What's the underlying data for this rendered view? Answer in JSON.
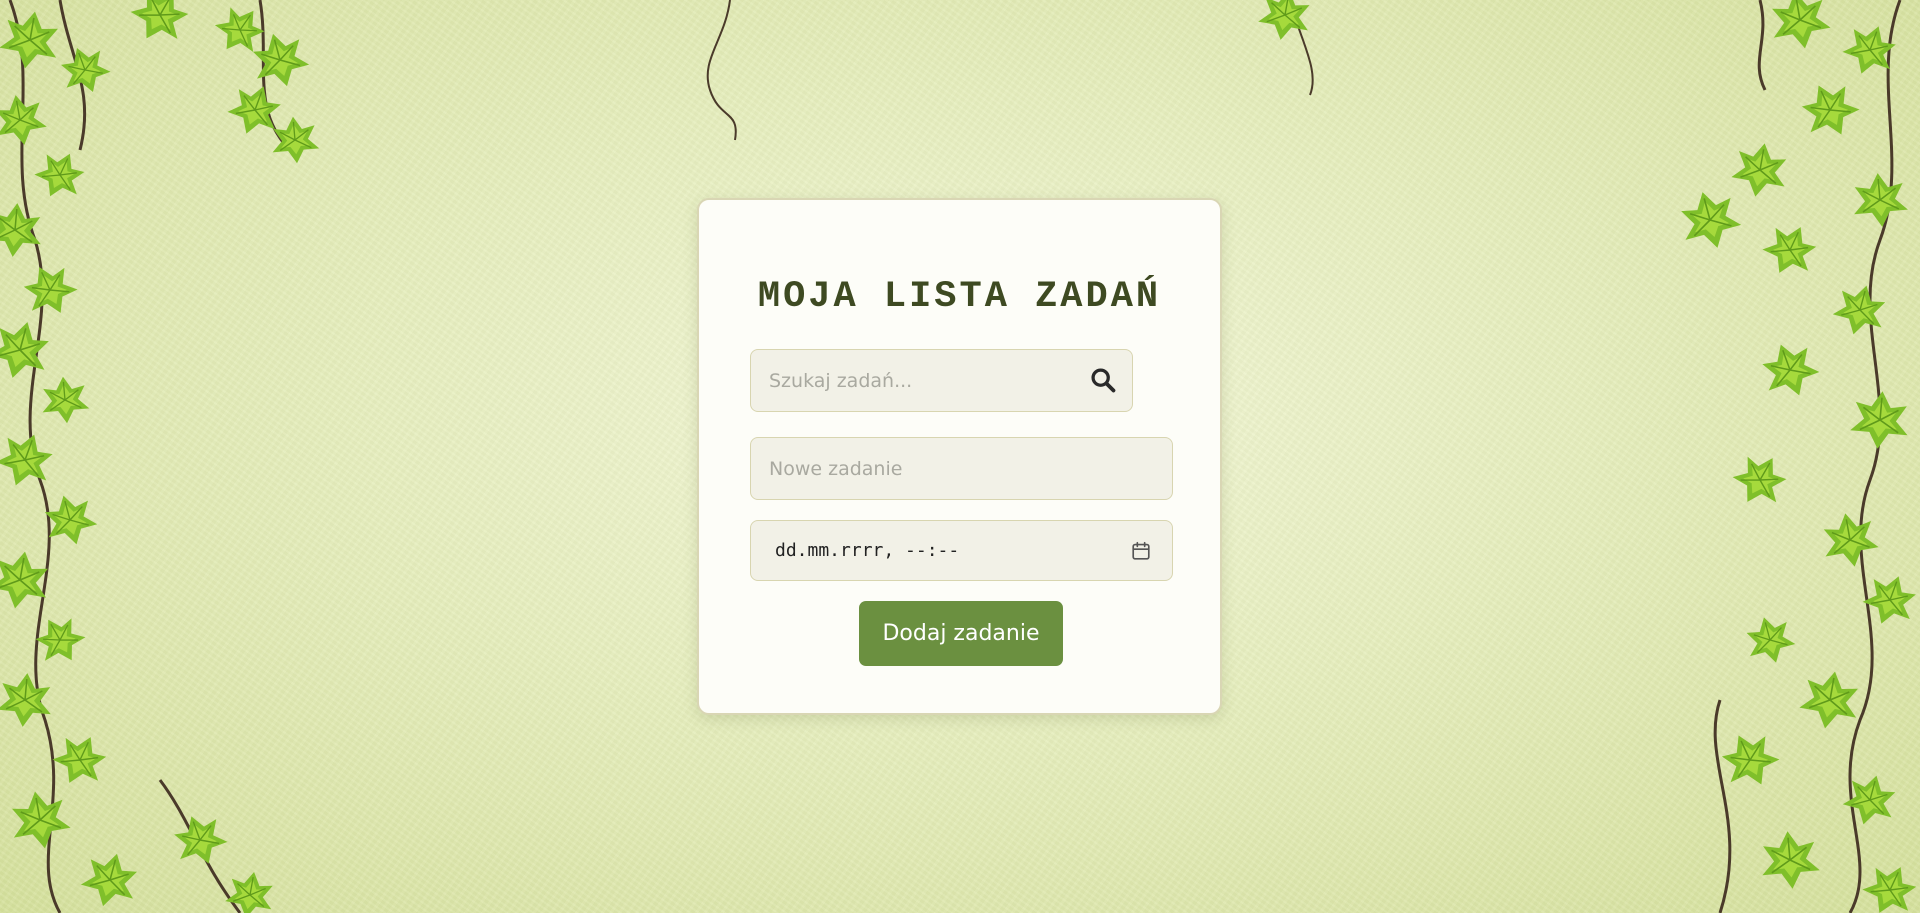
{
  "app": {
    "title": "MOJA LISTA ZADAŃ"
  },
  "search": {
    "placeholder": "Szukaj zadań...",
    "value": "",
    "icon": "search-icon"
  },
  "new_task": {
    "placeholder": "Nowe zadanie",
    "value": ""
  },
  "due_date": {
    "display": "dd.mm.rrrr, --:--",
    "icon": "calendar-icon"
  },
  "add_button": {
    "label": "Dodaj zadanie"
  },
  "colors": {
    "accent": "#6b9040",
    "title": "#3e4a22",
    "card_background": "#fdfdf8",
    "field_background": "#f2f1e7",
    "page_background": "#e6eebd"
  }
}
